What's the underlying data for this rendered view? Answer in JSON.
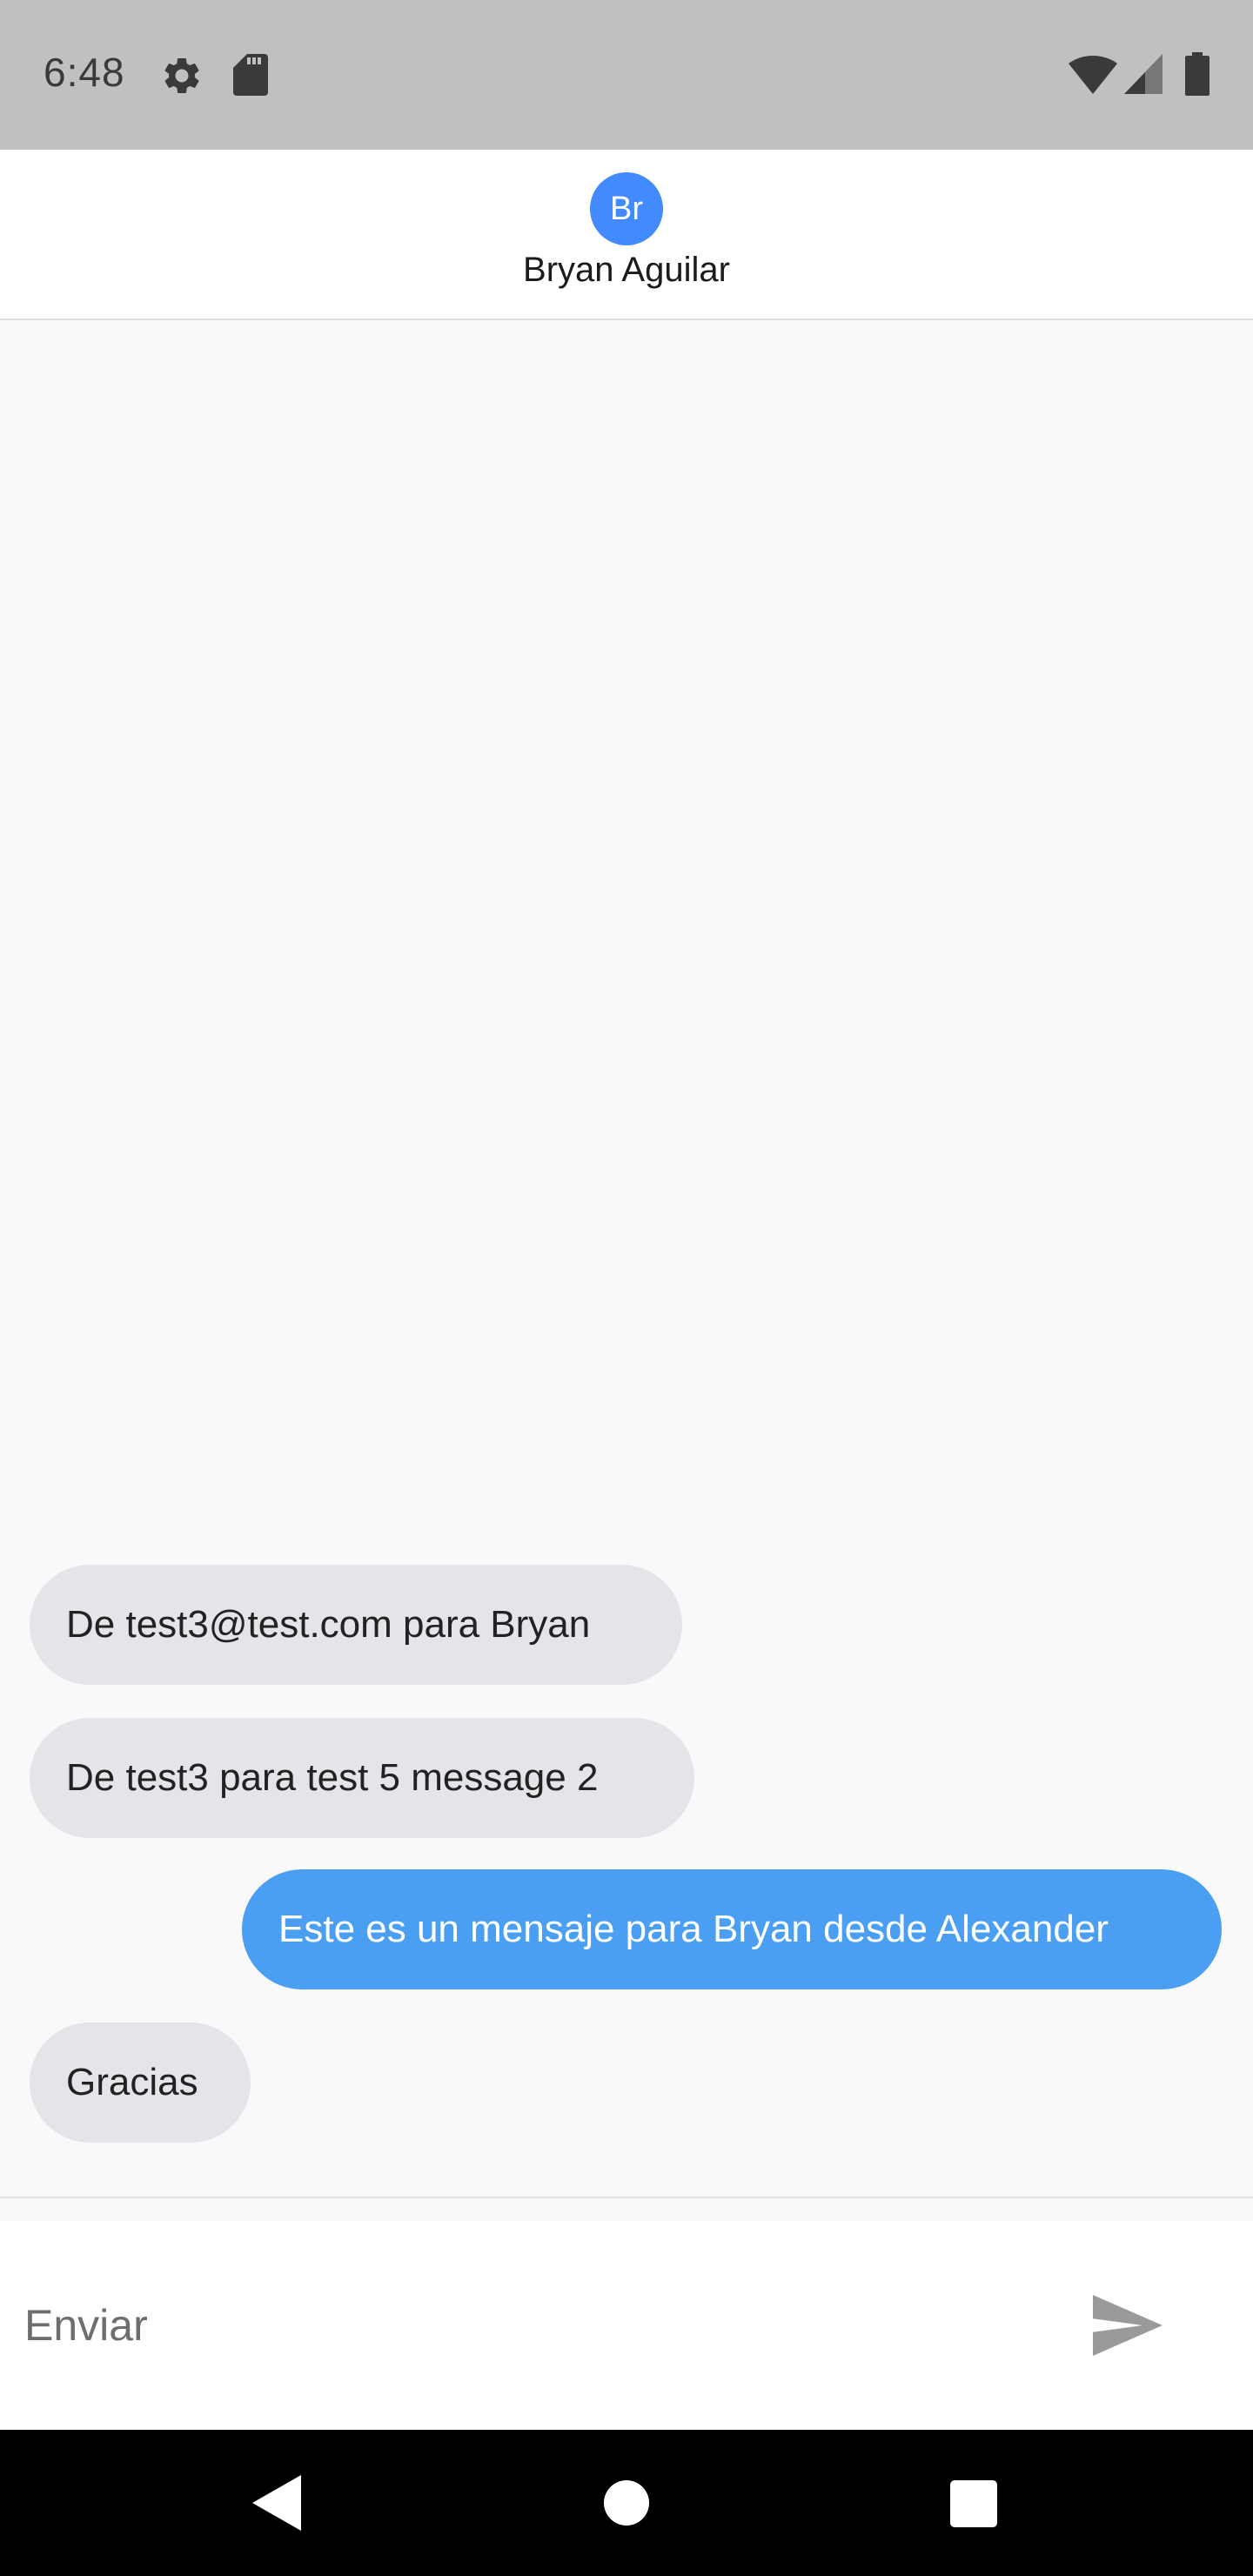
{
  "status_bar": {
    "time": "6:48",
    "icons": [
      "gear-icon",
      "sd-card-icon",
      "wifi-icon",
      "signal-icon",
      "battery-icon"
    ]
  },
  "header": {
    "avatar_initials": "Br",
    "contact_name": "Bryan Aguilar",
    "avatar_color": "#448aff"
  },
  "messages": [
    {
      "text": "De test3@test.com para Bryan",
      "direction": "received"
    },
    {
      "text": "De test3 para test 5 message 2",
      "direction": "received"
    },
    {
      "text": "Este es un mensaje para Bryan desde Alexander",
      "direction": "sent"
    },
    {
      "text": "Gracias",
      "direction": "received"
    }
  ],
  "composer": {
    "placeholder": "Enviar",
    "value": "",
    "send_icon": "send-icon"
  },
  "nav": {
    "icons": [
      "back-icon",
      "home-icon",
      "recents-icon"
    ]
  },
  "colors": {
    "sent_bubble": "#4b9ff2",
    "received_bubble": "#e4e5e9",
    "background": "#f9f9f9"
  }
}
